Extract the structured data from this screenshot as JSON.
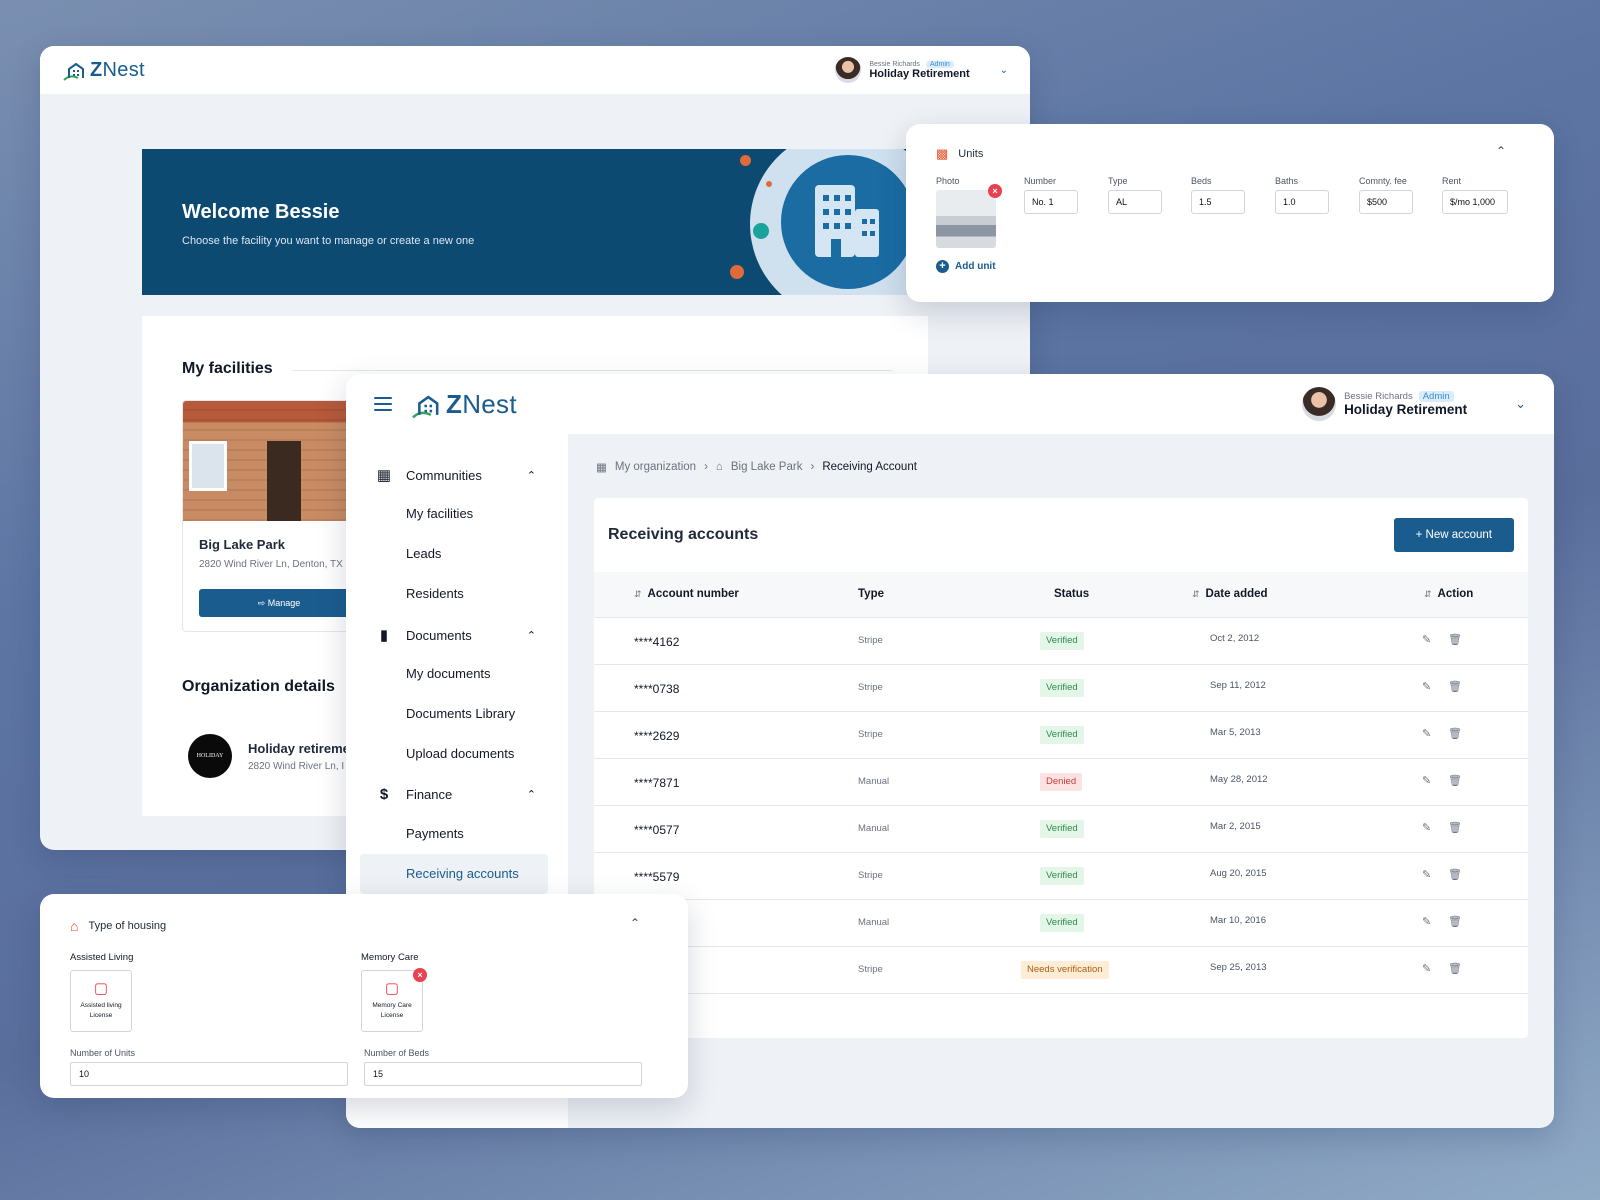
{
  "brand": {
    "name_z": "Z",
    "name_rest": "Nest"
  },
  "user": {
    "name": "Bessie Richards",
    "role": "Admin",
    "org": "Holiday Retirement"
  },
  "welcome": {
    "title": "Welcome Bessie",
    "subtitle": "Choose the facility you want to manage or create a new one"
  },
  "facilities": {
    "title": "My facilities",
    "card": {
      "name": "Big Lake Park",
      "address": "2820 Wind River Ln, Denton, TX",
      "manage_label": "Manage"
    }
  },
  "organization": {
    "title": "Organization details",
    "logo_text": "HOLIDAY",
    "name": "Holiday retireme",
    "address": "2820 Wind River Ln, I"
  },
  "units": {
    "title": "Units",
    "labels": {
      "photo": "Photo",
      "number": "Number",
      "type": "Type",
      "beds": "Beds",
      "baths": "Baths",
      "fee": "Comnty. fee",
      "rent": "Rent"
    },
    "values": {
      "number": "No. 1",
      "type": "AL",
      "beds": "1.5",
      "baths": "1.0",
      "fee": "$500",
      "rent": "$/mo 1,000"
    },
    "add_label": "Add unit"
  },
  "sidebar": {
    "groups": [
      {
        "label": "Communities",
        "icon": "building-icon",
        "items": [
          "My facilities",
          "Leads",
          "Residents"
        ]
      },
      {
        "label": "Documents",
        "icon": "clipboard-icon",
        "items": [
          "My documents",
          "Documents Library",
          "Upload documents"
        ]
      },
      {
        "label": "Finance",
        "icon": "dollar-icon",
        "items": [
          "Payments",
          "Receiving accounts"
        ]
      }
    ]
  },
  "breadcrumb": {
    "root": "My organization",
    "facility": "Big Lake Park",
    "current": "Receiving Account"
  },
  "accounts": {
    "title": "Receiving accounts",
    "new_label": "New account",
    "columns": {
      "account": "Account number",
      "type": "Type",
      "status": "Status",
      "date": "Date added",
      "action": "Action"
    },
    "rows": [
      {
        "account": "****4162",
        "type": "Stripe",
        "status": "Verified",
        "date": "Oct 2, 2012"
      },
      {
        "account": "****0738",
        "type": "Stripe",
        "status": "Verified",
        "date": "Sep 11, 2012"
      },
      {
        "account": "****2629",
        "type": "Stripe",
        "status": "Verified",
        "date": "Mar 5, 2013"
      },
      {
        "account": "****7871",
        "type": "Manual",
        "status": "Denied",
        "date": "May 28, 2012"
      },
      {
        "account": "****0577",
        "type": "Manual",
        "status": "Verified",
        "date": "Mar 2, 2015"
      },
      {
        "account": "****5579",
        "type": "Stripe",
        "status": "Verified",
        "date": "Aug 20, 2015"
      },
      {
        "account": "",
        "type": "Manual",
        "status": "Verified",
        "date": "Mar 10, 2016"
      },
      {
        "account": "",
        "type": "Stripe",
        "status": "Needs verification",
        "date": "Sep 25, 2013"
      }
    ]
  },
  "housing": {
    "title": "Type of housing",
    "assisted": {
      "title": "Assisted Living",
      "file": "Assisted living License",
      "count_label": "Number of Units",
      "count": "10"
    },
    "memory": {
      "title": "Memory Care",
      "file": "Memory Care License",
      "count_label": "Number of Beds",
      "count": "15"
    }
  },
  "colors": {
    "brand": "#1b5c8e",
    "hero": "#0d4a72",
    "verified": "#2f8a4e",
    "denied": "#c23b3b",
    "needs": "#b15f10"
  }
}
